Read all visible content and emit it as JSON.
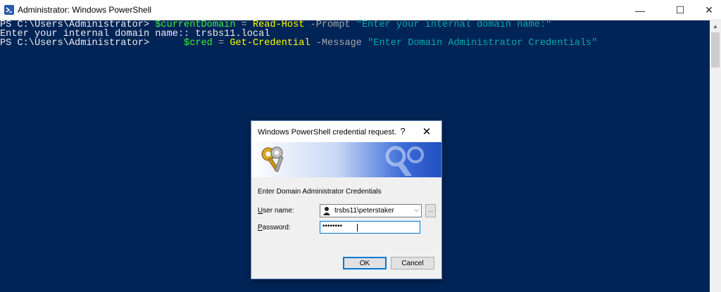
{
  "window": {
    "title": "Administrator: Windows PowerShell",
    "controls": {
      "minimize": "—",
      "maximize": "☐",
      "close": "✕"
    }
  },
  "console": {
    "lines": [
      {
        "prompt": "PS C:\\Users\\Administrator> ",
        "var": "$currentDomain",
        "op": " = ",
        "cmd": "Read-Host",
        "param": " -Prompt ",
        "str": "\"Enter your internal domain name:\""
      },
      {
        "text": "Enter your internal domain name:: trsbs11.local"
      },
      {
        "prompt": "PS C:\\Users\\Administrator>      ",
        "var": "$cred",
        "op": " = ",
        "cmd": "Get-Credential",
        "param": " -Message ",
        "str": "\"Enter Domain Administrator Credentials\""
      }
    ]
  },
  "dialog": {
    "title": "Windows PowerShell credential request.",
    "help": "?",
    "close": "✕",
    "message": "Enter Domain Administrator Credentials",
    "username_label_u": "U",
    "username_label_rest": "ser name:",
    "username_value": "trsbs11\\peterstaker",
    "password_label_u": "P",
    "password_label_rest": "assword:",
    "password_value": "••••••••",
    "browse": "...",
    "ok": "OK",
    "cancel": "Cancel"
  },
  "colors": {
    "console_bg": "#012456",
    "variable": "#3cf03c",
    "cmdlet": "#ffff00",
    "string": "#00aaaa",
    "parameter": "#a9a9a9"
  }
}
